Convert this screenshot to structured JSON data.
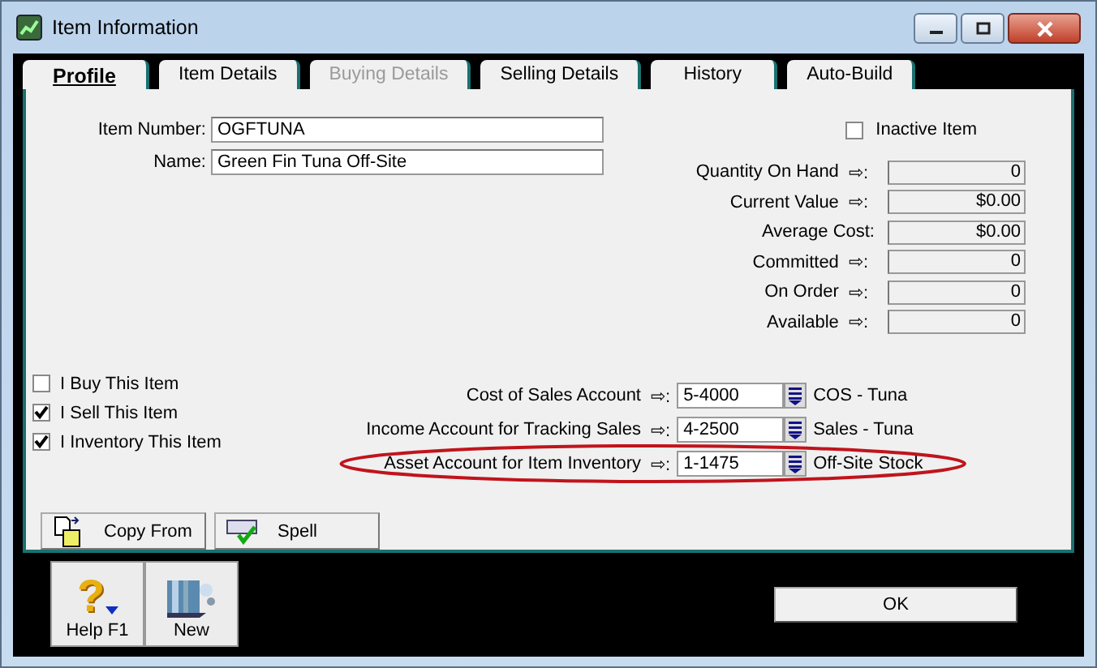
{
  "window": {
    "title": "Item Information"
  },
  "tabs": [
    {
      "label": "Profile",
      "selected": true,
      "disabled": false
    },
    {
      "label": "Item Details",
      "selected": false,
      "disabled": false
    },
    {
      "label": "Buying Details",
      "selected": false,
      "disabled": true
    },
    {
      "label": "Selling Details",
      "selected": false,
      "disabled": false
    },
    {
      "label": "History",
      "selected": false,
      "disabled": false
    },
    {
      "label": "Auto-Build",
      "selected": false,
      "disabled": false
    }
  ],
  "item_number": {
    "label": "Item Number:",
    "value": "OGFTUNA"
  },
  "name": {
    "label": "Name:",
    "value": "Green Fin Tuna Off-Site"
  },
  "inactive": {
    "label": "Inactive Item",
    "checked": false
  },
  "stats": [
    {
      "label": "Quantity On Hand",
      "arrow": "⇨:",
      "value": "0"
    },
    {
      "label": "Current Value",
      "arrow": "⇨:",
      "value": "$0.00"
    },
    {
      "label": "Average Cost:",
      "value": "$0.00"
    },
    {
      "label": "Committed",
      "arrow": "⇨:",
      "value": "0"
    },
    {
      "label": "On Order",
      "arrow": "⇨:",
      "value": "0"
    },
    {
      "label": "Available",
      "arrow": "⇨:",
      "value": "0"
    }
  ],
  "options": [
    {
      "label": "I Buy This Item",
      "checked": false
    },
    {
      "label": "I Sell This Item",
      "checked": true
    },
    {
      "label": "I Inventory This Item",
      "checked": true
    }
  ],
  "accounts": [
    {
      "label": "Cost of Sales Account",
      "arrow": "⇨:",
      "value": "5-4000",
      "account_name": "COS - Tuna",
      "highlighted": false
    },
    {
      "label": "Income Account for Tracking Sales",
      "arrow": "⇨:",
      "value": "4-2500",
      "account_name": "Sales - Tuna",
      "highlighted": false
    },
    {
      "label": "Asset Account for Item Inventory",
      "arrow": "⇨:",
      "value": "1-1475",
      "account_name": "Off-Site Stock",
      "highlighted": true
    }
  ],
  "panel_buttons": [
    {
      "label": "Copy From",
      "kind": "copy"
    },
    {
      "label": "Spell",
      "kind": "spell"
    }
  ],
  "toolbar": [
    {
      "label": "Help F1",
      "kind": "help",
      "glyph": "?"
    },
    {
      "label": "New",
      "kind": "new"
    }
  ],
  "ok_button": "OK"
}
